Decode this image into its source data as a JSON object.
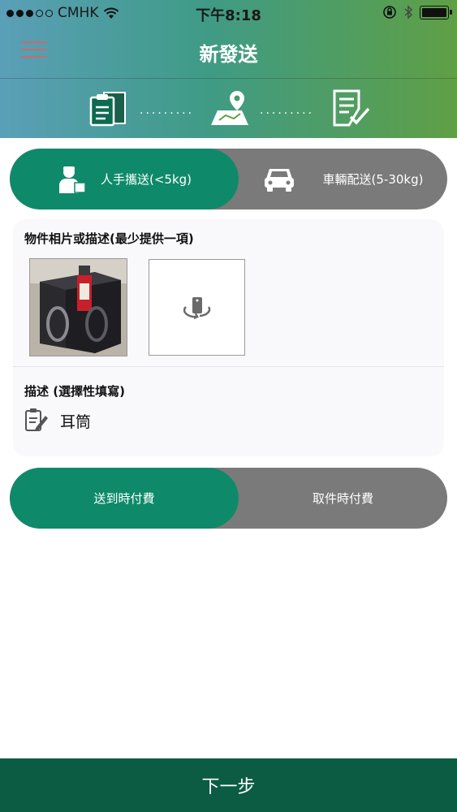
{
  "status_bar": {
    "carrier": "CMHK",
    "time": "下午8:18"
  },
  "nav": {
    "title": "新發送"
  },
  "delivery_mode": {
    "options": [
      {
        "label": "人手攜送(<5kg)",
        "icon": "courier-icon",
        "selected": true
      },
      {
        "label": "車輛配送(5-30kg)",
        "icon": "car-icon",
        "selected": false
      }
    ]
  },
  "item": {
    "photo_label": "物件相片或描述(最少提供一項)",
    "description_label": "描述 (選擇性填寫)",
    "description_value": "耳筒"
  },
  "payment": {
    "options": [
      {
        "label": "送到時付費",
        "selected": true
      },
      {
        "label": "取件時付費",
        "selected": false
      }
    ]
  },
  "footer": {
    "next_label": "下一步"
  },
  "colors": {
    "accent": "#0e8a6a",
    "inactive": "#7a7a7a",
    "footer": "#0b5c43"
  }
}
